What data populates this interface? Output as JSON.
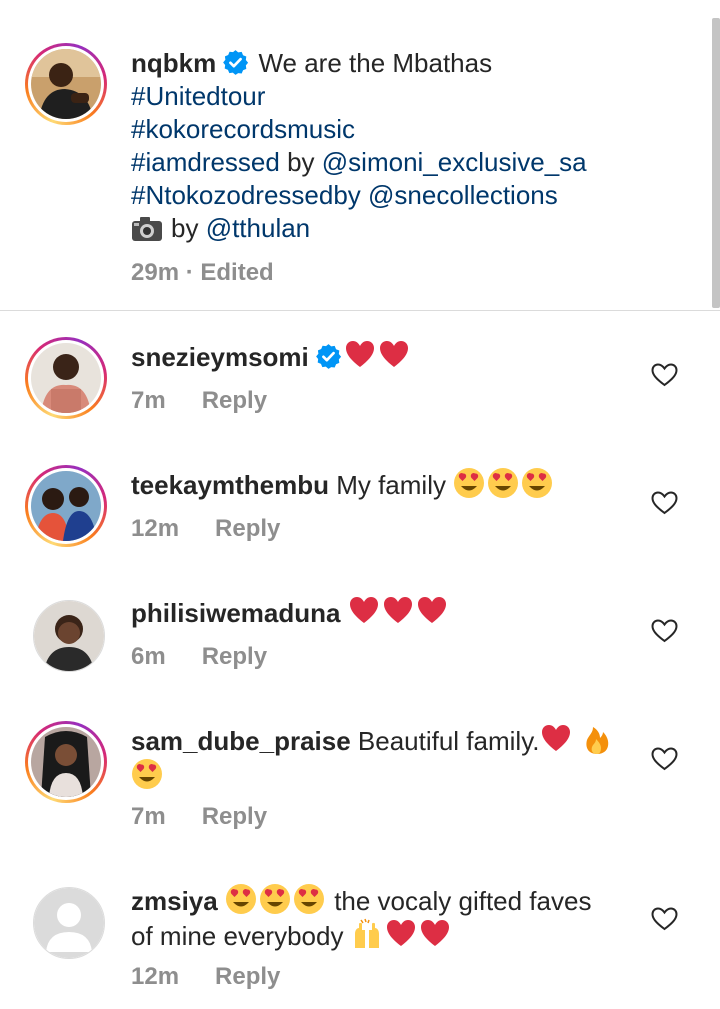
{
  "caption": {
    "username": "nqbkm",
    "first_line_text": " We are the Mbathas",
    "lines": [
      "#Unitedtour",
      "#kokorecordsmusic"
    ],
    "line3_tag": "#iamdressed",
    "line3_by": " by ",
    "line3_mention": "@simoni_exclusive_sa",
    "line4_tag": "#Ntokozodressedby",
    "line4_mention": " @snecollections",
    "line5_by": "by ",
    "line5_mention": "@tthulan",
    "time": "29m",
    "edited": " · Edited"
  },
  "comments": [
    {
      "username": "snezieymsomi",
      "text": "",
      "time": "7m",
      "reply": "Reply"
    },
    {
      "username": "teekaymthembu",
      "text": " My family ",
      "time": "12m",
      "reply": "Reply"
    },
    {
      "username": "philisiwemaduna",
      "text": "",
      "time": "6m",
      "reply": "Reply"
    },
    {
      "username": "sam_dube_praise",
      "text": " Beautiful family.",
      "time": "7m",
      "reply": "Reply"
    },
    {
      "username": "zmsiya",
      "text": " the vocaly gifted faves",
      "text2": "of mine everybody ",
      "time": "12m",
      "reply": "Reply"
    }
  ],
  "icons": [
    "verified-badge-icon",
    "heart-emoji-icon",
    "heart-eyes-emoji-icon",
    "fire-emoji-icon",
    "raising-hands-emoji-icon",
    "camera-emoji-icon",
    "like-outline-icon"
  ],
  "colors": {
    "link": "#00376b",
    "meta": "#8e8e8e",
    "verified": "#0095f6",
    "heart": "#e0245e"
  }
}
